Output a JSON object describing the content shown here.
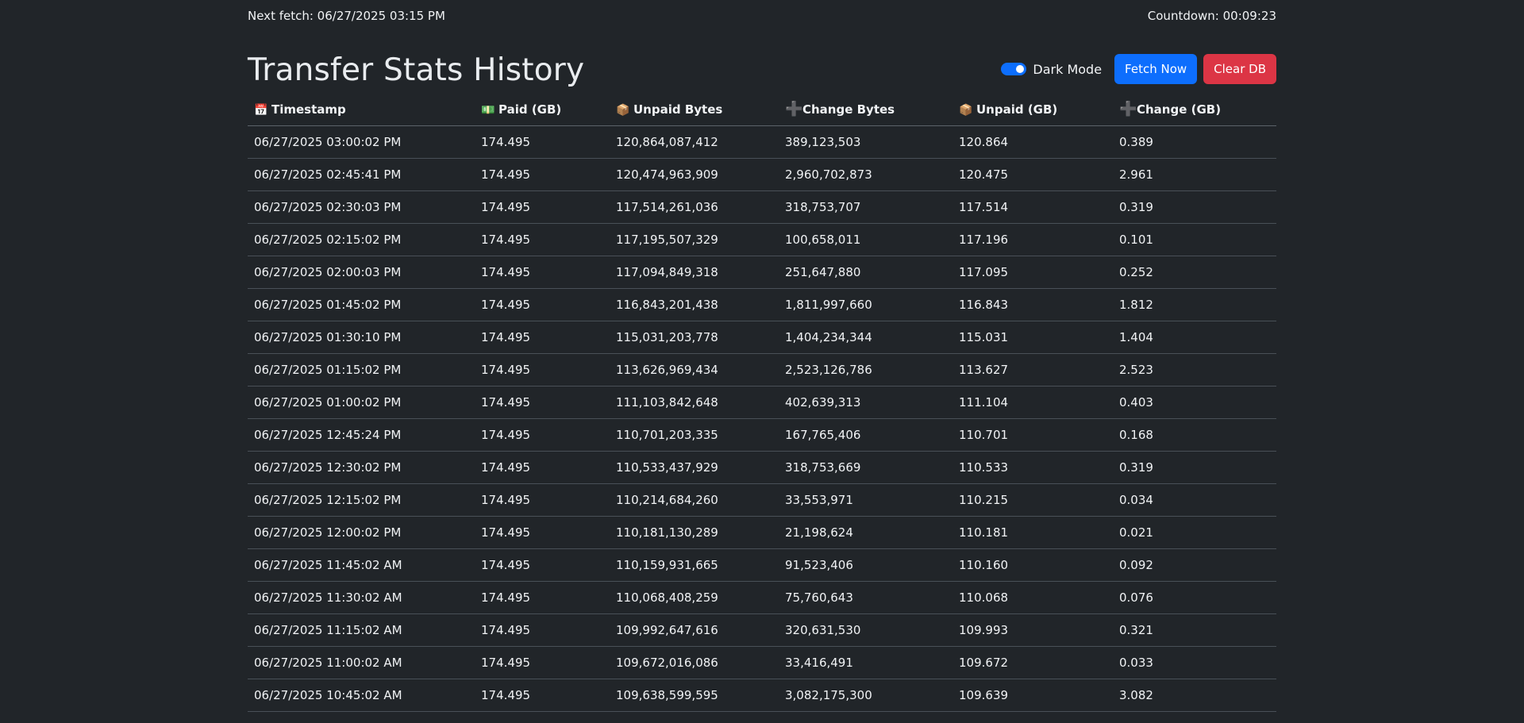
{
  "topbar": {
    "next_fetch": "Next fetch: 06/27/2025 03:15 PM",
    "countdown": "Countdown: 00:09:23"
  },
  "header": {
    "title": "Transfer Stats History",
    "dark_mode_label": "Dark Mode",
    "dark_mode_on": true,
    "fetch_button": "Fetch Now",
    "clear_button": "Clear DB"
  },
  "colors": {
    "background": "#212529",
    "primary": "#0d6efd",
    "danger": "#dc3545"
  },
  "table": {
    "columns": [
      {
        "icon": "calendar-icon",
        "glyph": "📅",
        "label": "Timestamp"
      },
      {
        "icon": "money-icon",
        "glyph": "💵",
        "label": "Paid (GB)"
      },
      {
        "icon": "package-icon",
        "glyph": "📦",
        "label": "Unpaid Bytes"
      },
      {
        "icon": "plus-icon",
        "glyph": "➕",
        "label": "Change Bytes"
      },
      {
        "icon": "package-icon",
        "glyph": "📦",
        "label": "Unpaid (GB)"
      },
      {
        "icon": "plus-icon",
        "glyph": "➕",
        "label": "Change (GB)"
      }
    ],
    "rows": [
      [
        "06/27/2025 03:00:02 PM",
        "174.495",
        "120,864,087,412",
        "389,123,503",
        "120.864",
        "0.389"
      ],
      [
        "06/27/2025 02:45:41 PM",
        "174.495",
        "120,474,963,909",
        "2,960,702,873",
        "120.475",
        "2.961"
      ],
      [
        "06/27/2025 02:30:03 PM",
        "174.495",
        "117,514,261,036",
        "318,753,707",
        "117.514",
        "0.319"
      ],
      [
        "06/27/2025 02:15:02 PM",
        "174.495",
        "117,195,507,329",
        "100,658,011",
        "117.196",
        "0.101"
      ],
      [
        "06/27/2025 02:00:03 PM",
        "174.495",
        "117,094,849,318",
        "251,647,880",
        "117.095",
        "0.252"
      ],
      [
        "06/27/2025 01:45:02 PM",
        "174.495",
        "116,843,201,438",
        "1,811,997,660",
        "116.843",
        "1.812"
      ],
      [
        "06/27/2025 01:30:10 PM",
        "174.495",
        "115,031,203,778",
        "1,404,234,344",
        "115.031",
        "1.404"
      ],
      [
        "06/27/2025 01:15:02 PM",
        "174.495",
        "113,626,969,434",
        "2,523,126,786",
        "113.627",
        "2.523"
      ],
      [
        "06/27/2025 01:00:02 PM",
        "174.495",
        "111,103,842,648",
        "402,639,313",
        "111.104",
        "0.403"
      ],
      [
        "06/27/2025 12:45:24 PM",
        "174.495",
        "110,701,203,335",
        "167,765,406",
        "110.701",
        "0.168"
      ],
      [
        "06/27/2025 12:30:02 PM",
        "174.495",
        "110,533,437,929",
        "318,753,669",
        "110.533",
        "0.319"
      ],
      [
        "06/27/2025 12:15:02 PM",
        "174.495",
        "110,214,684,260",
        "33,553,971",
        "110.215",
        "0.034"
      ],
      [
        "06/27/2025 12:00:02 PM",
        "174.495",
        "110,181,130,289",
        "21,198,624",
        "110.181",
        "0.021"
      ],
      [
        "06/27/2025 11:45:02 AM",
        "174.495",
        "110,159,931,665",
        "91,523,406",
        "110.160",
        "0.092"
      ],
      [
        "06/27/2025 11:30:02 AM",
        "174.495",
        "110,068,408,259",
        "75,760,643",
        "110.068",
        "0.076"
      ],
      [
        "06/27/2025 11:15:02 AM",
        "174.495",
        "109,992,647,616",
        "320,631,530",
        "109.993",
        "0.321"
      ],
      [
        "06/27/2025 11:00:02 AM",
        "174.495",
        "109,672,016,086",
        "33,416,491",
        "109.672",
        "0.033"
      ],
      [
        "06/27/2025 10:45:02 AM",
        "174.495",
        "109,638,599,595",
        "3,082,175,300",
        "109.639",
        "3.082"
      ]
    ]
  }
}
